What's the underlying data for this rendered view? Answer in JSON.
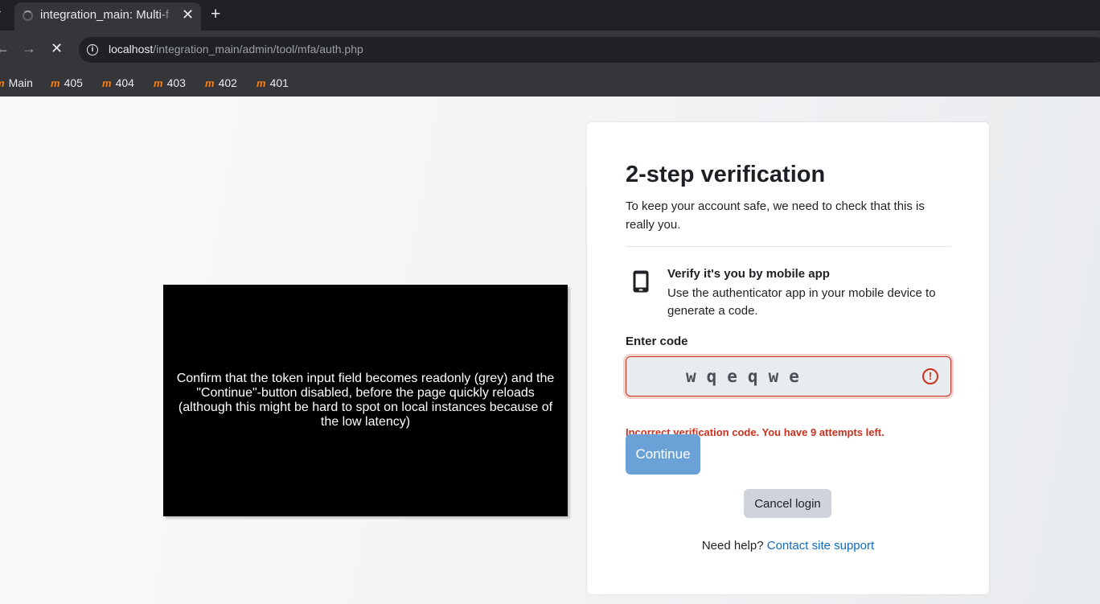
{
  "browser": {
    "tab_title": "integration_main: Multi-f",
    "url_host": "localhost",
    "url_path": "/integration_main/admin/tool/mfa/auth.php",
    "bookmarks": [
      {
        "label": "Main",
        "icon": "moodle-icon"
      },
      {
        "label": "405",
        "icon": "moodle-icon"
      },
      {
        "label": "404",
        "icon": "moodle-icon"
      },
      {
        "label": "403",
        "icon": "moodle-icon"
      },
      {
        "label": "402",
        "icon": "moodle-icon"
      },
      {
        "label": "401",
        "icon": "moodle-icon"
      }
    ],
    "bookmark_icon_glyph": "m"
  },
  "video_overlay": {
    "text": "Confirm that the token input field becomes readonly (grey) and the \"Continue\"-button disabled, before the page quickly reloads (although this might be hard to spot on local instances because of the low latency)"
  },
  "mfa": {
    "title": "2-step verification",
    "description": "To keep your account safe, we need to check that this is really you.",
    "factor_heading": "Verify it's you by mobile app",
    "factor_description": "Use the authenticator app in your mobile device to generate a code.",
    "code_label": "Enter code",
    "code_value": "wqeqwe",
    "error_message": "Incorrect verification code. You have 9 attempts left.",
    "continue_label": "Continue",
    "cancel_label": "Cancel login",
    "help_text": "Need help?",
    "help_link": "Contact site support"
  },
  "colors": {
    "accent": "#0f6cbf",
    "error": "#ca3120",
    "continue_disabled": "#6aa1d6"
  }
}
